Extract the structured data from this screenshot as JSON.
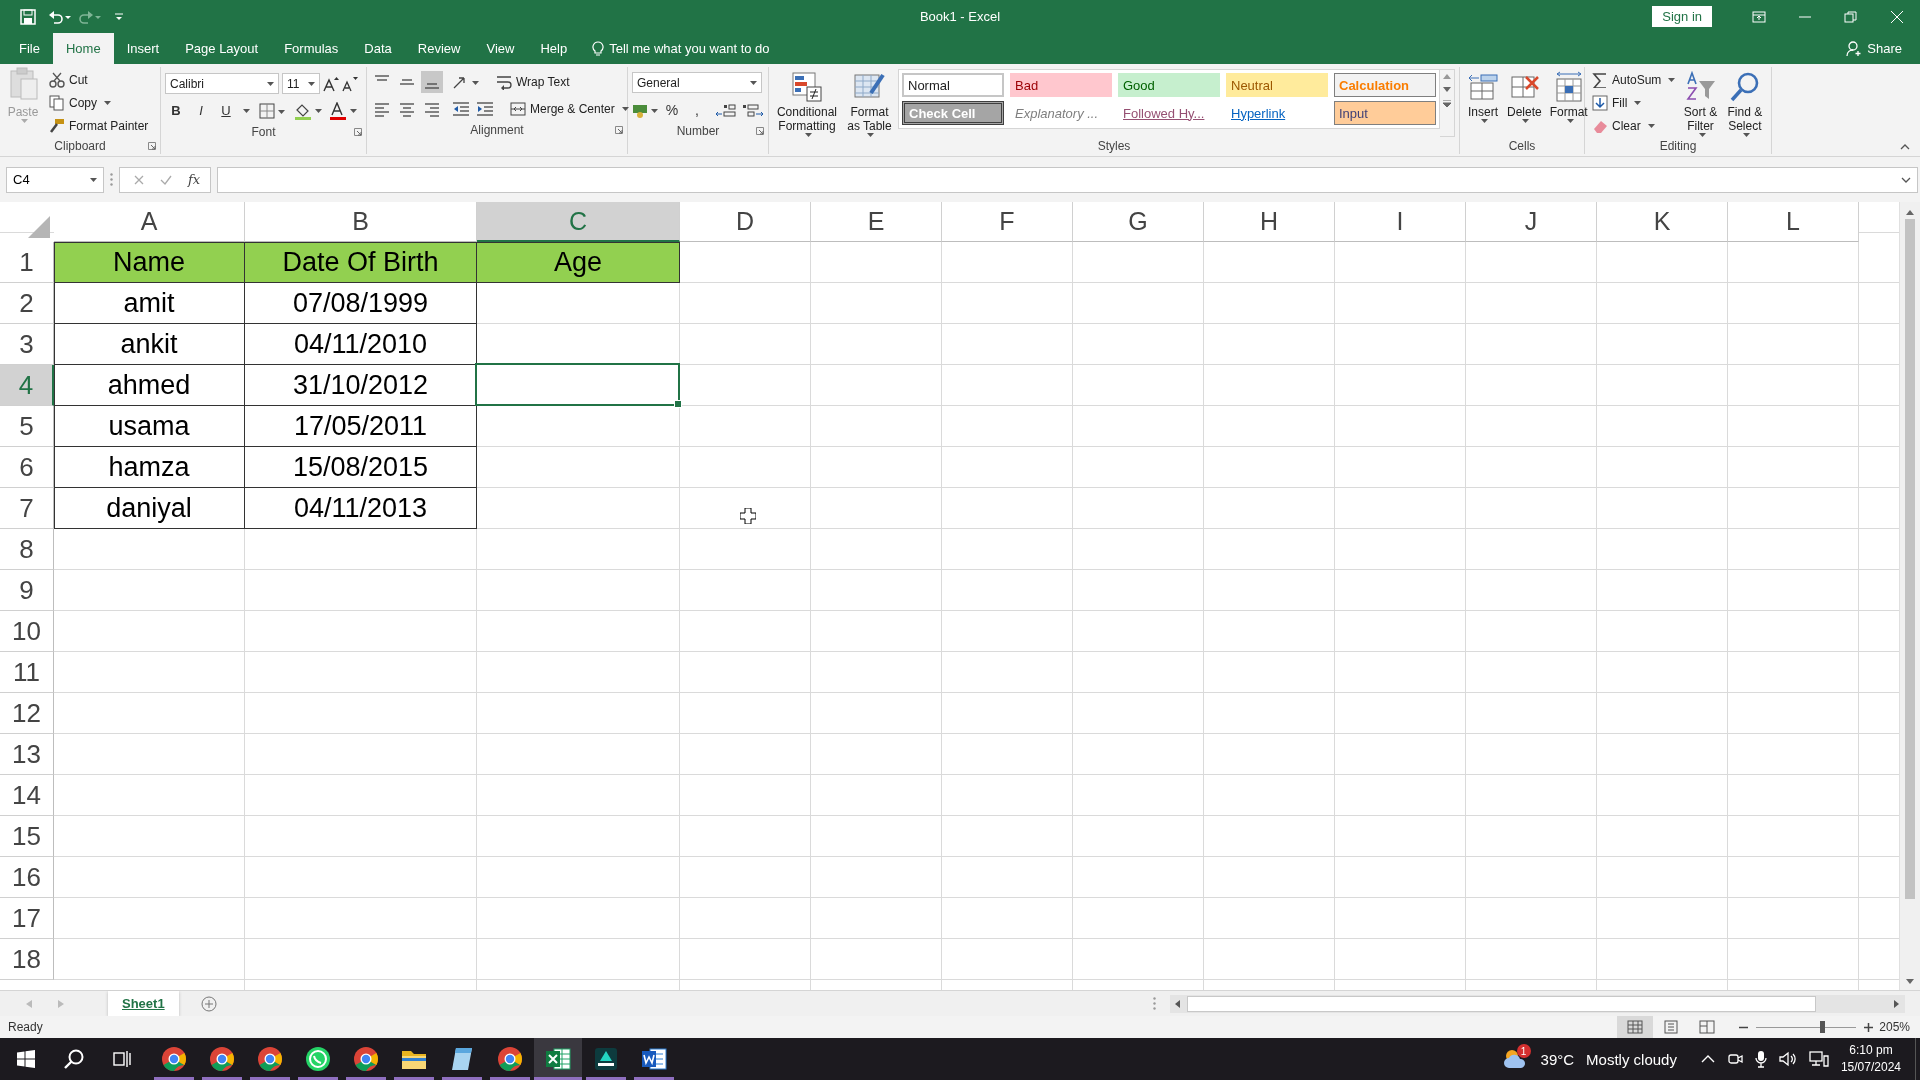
{
  "window": {
    "title": "Book1  -  Excel",
    "sign_in": "Sign in"
  },
  "ribbon_tabs": [
    {
      "label": "File",
      "selected": false
    },
    {
      "label": "Home",
      "selected": true
    },
    {
      "label": "Insert",
      "selected": false
    },
    {
      "label": "Page Layout",
      "selected": false
    },
    {
      "label": "Formulas",
      "selected": false
    },
    {
      "label": "Data",
      "selected": false
    },
    {
      "label": "Review",
      "selected": false
    },
    {
      "label": "View",
      "selected": false
    },
    {
      "label": "Help",
      "selected": false
    }
  ],
  "tell_me": {
    "placeholder": "Tell me what you want to do"
  },
  "share": "Share",
  "clipboard": {
    "label": "Clipboard",
    "paste": {
      "label": "Paste",
      "disabled": true
    },
    "commands": [
      "Cut",
      "Copy",
      "Format Painter"
    ]
  },
  "font": {
    "label": "Font",
    "family": "Calibri",
    "size": "11",
    "styles": [
      "B",
      "I",
      "U"
    ]
  },
  "alignment": {
    "label": "Alignment",
    "wrap": "Wrap Text",
    "merge": "Merge & Center",
    "vertical_align": [
      {
        "selected": false
      },
      {
        "selected": false
      },
      {
        "selected": true
      }
    ]
  },
  "number": {
    "label": "Number",
    "format": "General",
    "symbols": [
      "%",
      ","
    ]
  },
  "styles": {
    "label": "Styles",
    "commands": [
      "Conditional Formatting",
      "Format as Table"
    ],
    "gallery": [
      {
        "text": "Normal",
        "kind": "normal"
      },
      {
        "text": "Bad",
        "kind": "bad"
      },
      {
        "text": "Good",
        "kind": "good"
      },
      {
        "text": "Neutral",
        "kind": "neutral"
      },
      {
        "text": "Calculation",
        "kind": "calculation"
      },
      {
        "text": "Check Cell",
        "kind": "check"
      },
      {
        "text": "Explanatory ...",
        "kind": "explanatory"
      },
      {
        "text": "Followed Hy...",
        "kind": "followed"
      },
      {
        "text": "Hyperlink",
        "kind": "hyperlink"
      },
      {
        "text": "Input",
        "kind": "input"
      }
    ]
  },
  "cells": {
    "label": "Cells",
    "commands": [
      "Insert",
      "Delete",
      "Format"
    ]
  },
  "editing": {
    "label": "Editing",
    "commands": [
      "AutoSum",
      "Fill",
      "Clear"
    ],
    "large": [
      "Sort & Filter",
      "Find & Select"
    ]
  },
  "formula_bar": {
    "name_box": "C4",
    "function_label": "fx"
  },
  "sheet": {
    "columns": [
      {
        "label": "A",
        "selected": false
      },
      {
        "label": "B",
        "selected": false
      },
      {
        "label": "C",
        "selected": true
      },
      {
        "label": "D",
        "selected": false
      },
      {
        "label": "E",
        "selected": false
      },
      {
        "label": "F",
        "selected": false
      },
      {
        "label": "G",
        "selected": false
      },
      {
        "label": "H",
        "selected": false
      },
      {
        "label": "I",
        "selected": false
      },
      {
        "label": "J",
        "selected": false
      },
      {
        "label": "K",
        "selected": false
      },
      {
        "label": "L",
        "selected": false
      }
    ],
    "rows": [
      {
        "label": "1",
        "selected": false,
        "cells": [
          {
            "text": "Name",
            "kind": "header"
          },
          {
            "text": "Date Of Birth",
            "kind": "header"
          },
          {
            "text": "Age",
            "kind": "header"
          }
        ]
      },
      {
        "label": "2",
        "selected": false,
        "cells": [
          {
            "text": "amit",
            "kind": "data"
          },
          {
            "text": "07/08/1999",
            "kind": "data"
          }
        ]
      },
      {
        "label": "3",
        "selected": false,
        "cells": [
          {
            "text": "ankit",
            "kind": "data"
          },
          {
            "text": "04/11/2010",
            "kind": "data"
          }
        ]
      },
      {
        "label": "4",
        "selected": true,
        "cells": [
          {
            "text": "ahmed",
            "kind": "data"
          },
          {
            "text": "31/10/2012",
            "kind": "data"
          }
        ]
      },
      {
        "label": "5",
        "selected": false,
        "cells": [
          {
            "text": "usama",
            "kind": "data"
          },
          {
            "text": "17/05/2011",
            "kind": "data"
          }
        ]
      },
      {
        "label": "6",
        "selected": false,
        "cells": [
          {
            "text": "hamza",
            "kind": "data"
          },
          {
            "text": "15/08/2015",
            "kind": "data"
          }
        ]
      },
      {
        "label": "7",
        "selected": false,
        "cells": [
          {
            "text": "daniyal",
            "kind": "data"
          },
          {
            "text": "04/11/2013",
            "kind": "data"
          }
        ]
      },
      {
        "label": "8",
        "selected": false
      },
      {
        "label": "9",
        "selected": false
      },
      {
        "label": "10",
        "selected": false
      },
      {
        "label": "11",
        "selected": false
      },
      {
        "label": "12",
        "selected": false
      },
      {
        "label": "13",
        "selected": false
      },
      {
        "label": "14",
        "selected": false
      },
      {
        "label": "15",
        "selected": false
      },
      {
        "label": "16",
        "selected": false
      },
      {
        "label": "17",
        "selected": false
      },
      {
        "label": "18",
        "selected": false
      }
    ]
  },
  "sheet_tabs": [
    {
      "label": "Sheet1",
      "selected": true
    }
  ],
  "status_bar": {
    "status": "Ready",
    "views": [
      {
        "selected": true
      },
      {
        "selected": false
      },
      {
        "selected": false
      }
    ],
    "zoom": {
      "level": 0.66,
      "reading": "205%"
    }
  },
  "taskbar": {
    "apps": [
      {
        "kind": "chrome",
        "selected": false
      },
      {
        "kind": "chrome",
        "selected": false
      },
      {
        "kind": "chrome",
        "selected": false
      },
      {
        "kind": "whatsapp",
        "selected": false
      },
      {
        "kind": "chrome",
        "selected": false
      },
      {
        "kind": "folder",
        "selected": false
      },
      {
        "kind": "notepad",
        "selected": false
      },
      {
        "kind": "chrome",
        "selected": false
      },
      {
        "kind": "excel",
        "selected": true
      },
      {
        "kind": "editor",
        "selected": false
      },
      {
        "kind": "word",
        "selected": false
      }
    ],
    "weather": {
      "badge": "1",
      "temperature": "39°C",
      "condition": "Mostly cloudy"
    },
    "clock": {
      "time": "6:10 pm",
      "date": "15/07/2024"
    }
  }
}
